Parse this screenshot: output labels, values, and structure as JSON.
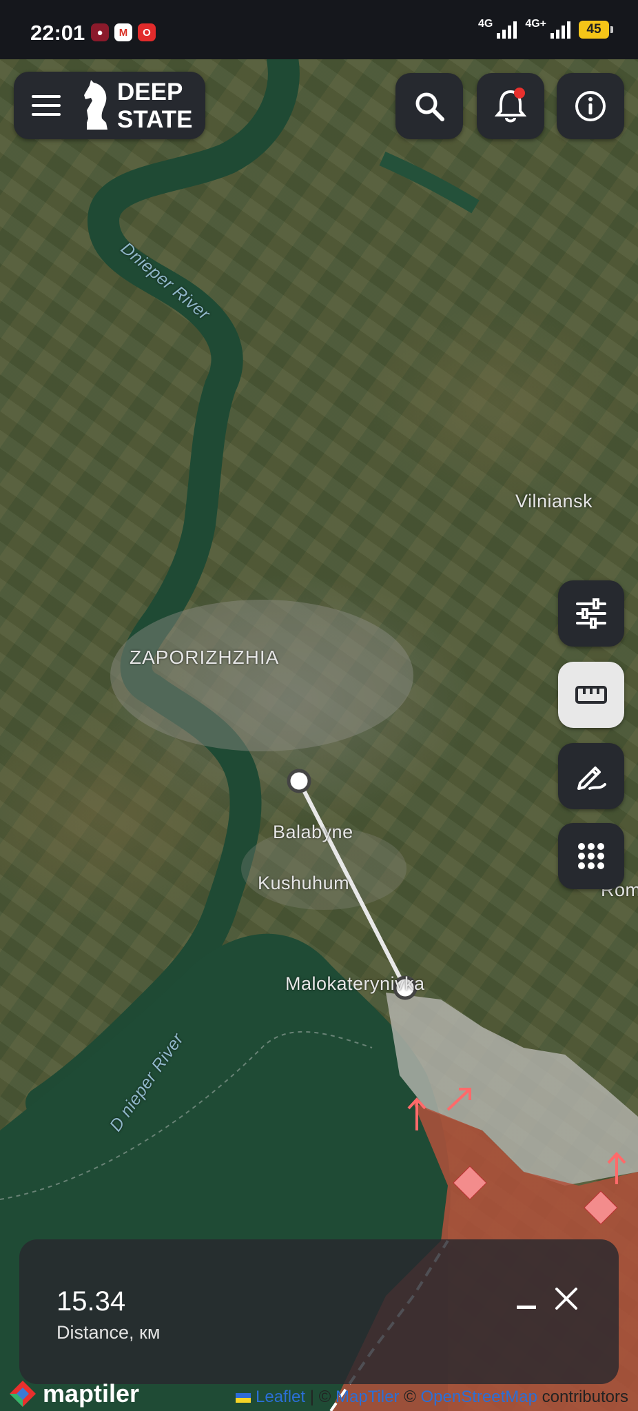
{
  "status_bar": {
    "time": "22:01",
    "app_icons": [
      {
        "name": "notification-app-icon",
        "glyph": "◉",
        "color": "#c0392b"
      },
      {
        "name": "gmail-icon",
        "glyph": "M",
        "color": "#ffffff"
      },
      {
        "name": "opera-icon",
        "glyph": "O",
        "color": "#e22b2b"
      }
    ],
    "network_1": "4G",
    "network_2": "4G+",
    "battery": "45"
  },
  "header": {
    "brand_line_1": "DEEP",
    "brand_line_2": "STATE",
    "menu_icon": "hamburger-menu-icon",
    "search_icon": "search-icon",
    "notifications_icon": "bell-icon",
    "info_icon": "info-icon"
  },
  "toolbar": {
    "filters_icon": "sliders-icon",
    "measure_icon": "ruler-icon",
    "draw_icon": "pencil-icon",
    "grid_icon": "grid-icon"
  },
  "map_labels": {
    "river_north": "Dnieper River",
    "river_south": "D nieper River",
    "city_main": "ZAPORIZHZHIA",
    "town_east": "Vilniansk",
    "town_1": "Balabyne",
    "town_2": "Kushuhum",
    "town_3": "Malokaterynivka",
    "town_edge": "Rom"
  },
  "measure_panel": {
    "distance_value": "15.34",
    "distance_label": "Distance, км"
  },
  "attribution": {
    "leaflet": "Leaflet",
    "sep": " | © ",
    "maptiler": "MapTiler",
    "osm_sep": " © ",
    "osm": "OpenStreetMap",
    "contributors": " contributors",
    "maptiler_logo": "maptiler"
  },
  "colors": {
    "accent_alert": "#e8302d",
    "frontline_red": "#b2513b",
    "grey_zone": "#b7b7b0",
    "button_dark": "#26292f"
  }
}
